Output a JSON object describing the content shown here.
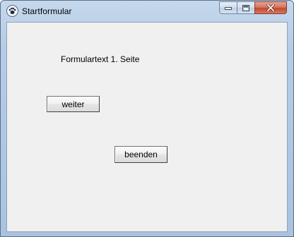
{
  "window": {
    "title": "Startformular",
    "app_icon": "paw-icon",
    "controls": {
      "minimize": "minimize-icon",
      "maximize": "maximize-icon",
      "close": "close-icon"
    },
    "close_color": "#c7432a"
  },
  "form": {
    "label_text": "Formulartext 1. Seite",
    "weiter_label": "weiter",
    "beenden_label": "beenden"
  }
}
